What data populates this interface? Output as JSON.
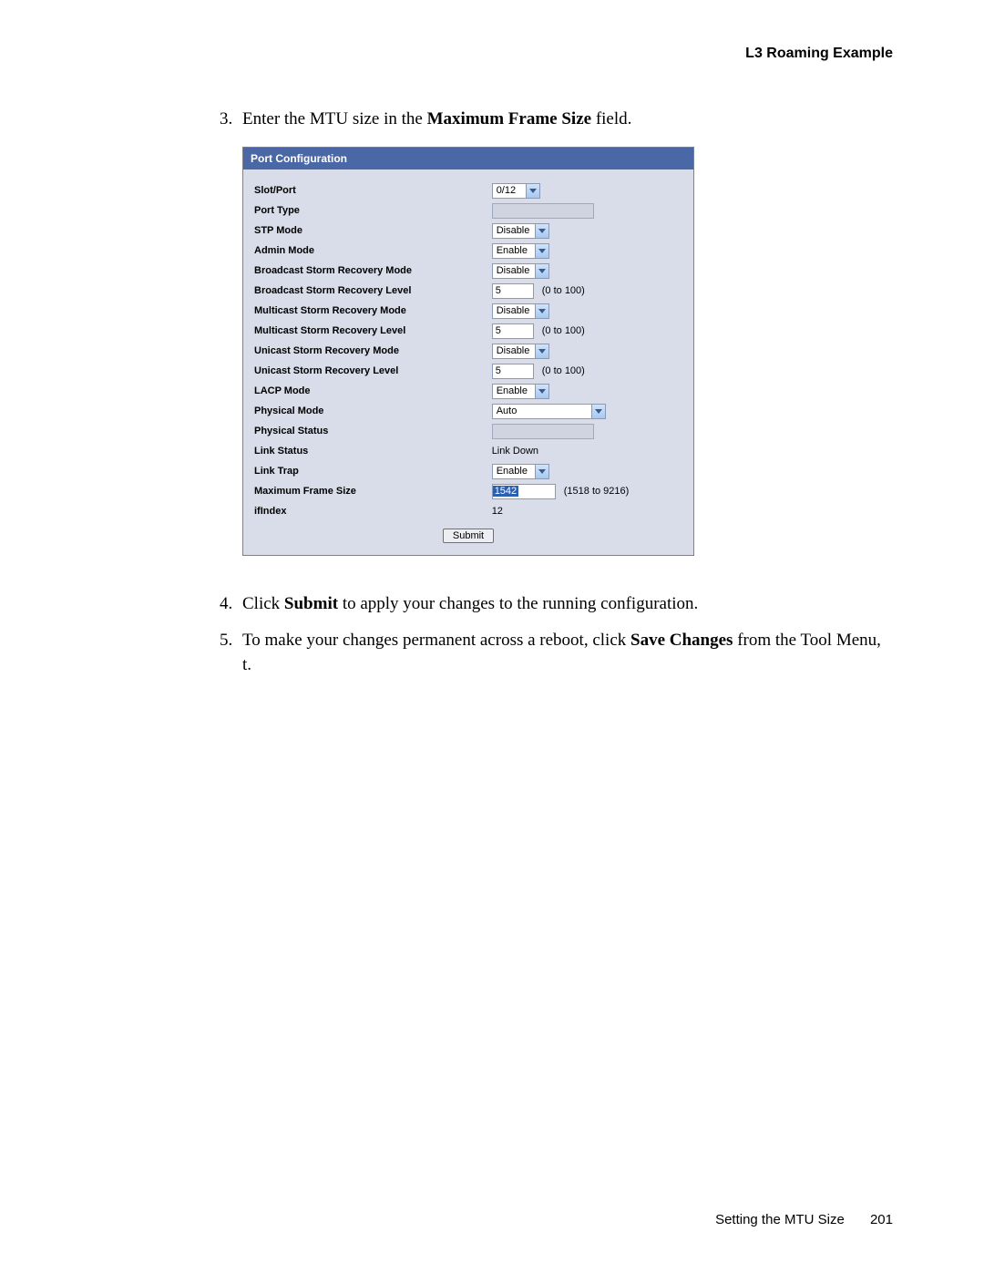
{
  "header": {
    "title": "L3 Roaming Example"
  },
  "steps": {
    "s3_pre": "Enter the MTU size in the ",
    "s3_bold": "Maximum Frame Size",
    "s3_post": " field.",
    "s4_pre": "Click ",
    "s4_bold": "Submit",
    "s4_post": " to apply your changes to the running configuration.",
    "s5_pre": "To make your changes permanent across a reboot, click ",
    "s5_bold": "Save Changes",
    "s5_post": " from the Tool Menu, t."
  },
  "panel": {
    "title": "Port Configuration",
    "rows": {
      "slot_port": {
        "label": "Slot/Port",
        "value": "0/12"
      },
      "port_type": {
        "label": "Port Type"
      },
      "stp_mode": {
        "label": "STP Mode",
        "value": "Disable"
      },
      "admin_mode": {
        "label": "Admin Mode",
        "value": "Enable"
      },
      "bcast_mode": {
        "label": "Broadcast Storm Recovery Mode",
        "value": "Disable"
      },
      "bcast_level": {
        "label": "Broadcast Storm Recovery Level",
        "value": "5",
        "hint": "(0 to 100)"
      },
      "mcast_mode": {
        "label": "Multicast Storm Recovery Mode",
        "value": "Disable"
      },
      "mcast_level": {
        "label": "Multicast Storm Recovery Level",
        "value": "5",
        "hint": "(0 to 100)"
      },
      "ucast_mode": {
        "label": "Unicast Storm Recovery Mode",
        "value": "Disable"
      },
      "ucast_level": {
        "label": "Unicast Storm Recovery Level",
        "value": "5",
        "hint": "(0 to 100)"
      },
      "lacp_mode": {
        "label": "LACP Mode",
        "value": "Enable"
      },
      "phys_mode": {
        "label": "Physical Mode",
        "value": "Auto"
      },
      "phys_status": {
        "label": "Physical Status"
      },
      "link_status": {
        "label": "Link Status",
        "value": "Link Down"
      },
      "link_trap": {
        "label": "Link Trap",
        "value": "Enable"
      },
      "max_frame": {
        "label": "Maximum Frame Size",
        "value": "1542",
        "hint": "(1518 to 9216)"
      },
      "ifindex": {
        "label": "ifIndex",
        "value": "12"
      }
    },
    "submit": "Submit"
  },
  "footer": {
    "section": "Setting the MTU Size",
    "page": "201"
  }
}
